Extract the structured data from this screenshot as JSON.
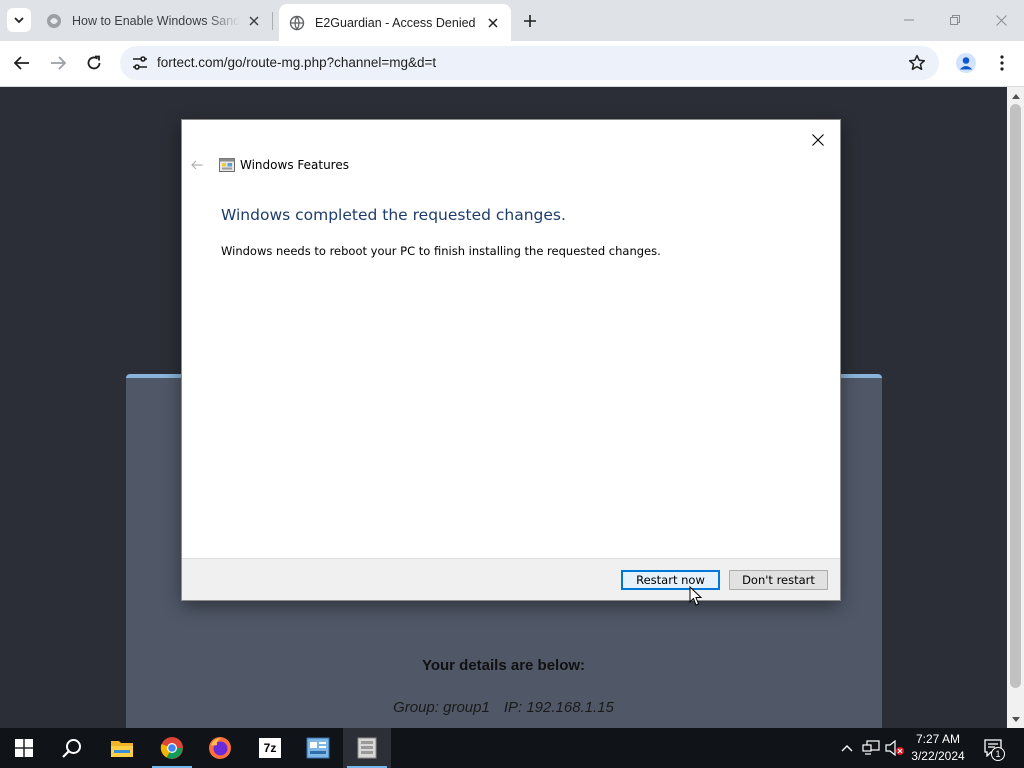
{
  "browser": {
    "tabs": [
      {
        "title": "How to Enable Windows Sandbox",
        "favicon": "site-favicon",
        "active": false
      },
      {
        "title": "E2Guardian - Access Denied",
        "favicon": "globe-icon",
        "active": true
      }
    ],
    "url": "fortect.com/go/route-mg.php?channel=mg&d=t"
  },
  "page": {
    "details_heading": "Your details are below:",
    "group_text": "Group: group1",
    "ip_text": "IP: 192.168.1.15"
  },
  "dialog": {
    "app_title": "Windows Features",
    "heading": "Windows completed the requested changes.",
    "message": "Windows needs to reboot your PC to finish installing the requested changes.",
    "restart_label": "Restart now",
    "dont_restart_label": "Don't restart"
  },
  "taskbar": {
    "pinned": [
      "start-icon",
      "search-icon",
      "file-explorer-icon",
      "chrome-icon",
      "firefox-icon",
      "7zip-icon",
      "control-panel-icon",
      "windows-features-icon"
    ],
    "sevenzip_label": "7z",
    "time": "7:27 AM",
    "date": "3/22/2024",
    "notification_count": "1"
  },
  "colors": {
    "dialog_heading": "#1e3d6e",
    "primary_button_border": "#0078d7",
    "card_accent": "#8ab4dc",
    "taskbar_bg": "#101418"
  }
}
